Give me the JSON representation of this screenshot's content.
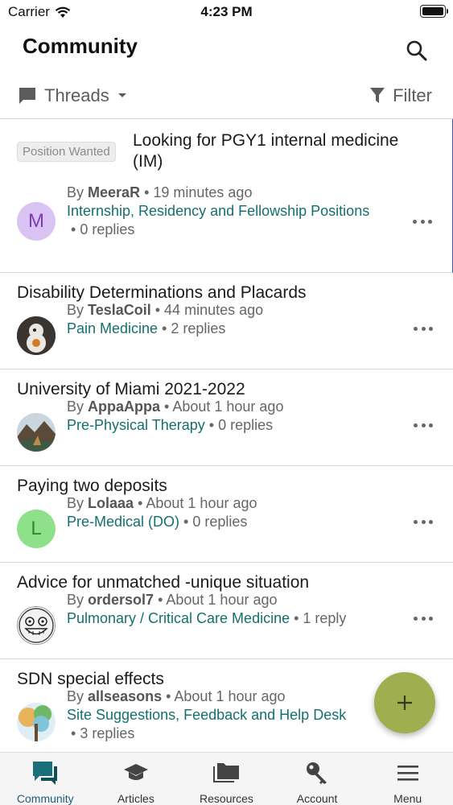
{
  "status_bar": {
    "carrier": "Carrier",
    "time": "4:23 PM"
  },
  "header": {
    "title": "Community"
  },
  "toolbar": {
    "threads_label": "Threads",
    "filter_label": "Filter"
  },
  "threads": [
    {
      "tag": "Position Wanted",
      "title": "Looking for PGY1 internal medicine (IM)",
      "by": "By",
      "author": "MeeraR",
      "time": "19 minutes ago",
      "category": "Internship, Residency and Fellowship Positions",
      "replies": "0 replies",
      "avatar_letter": "M"
    },
    {
      "title": "Disability Determinations and Placards",
      "by": "By",
      "author": "TeslaCoil",
      "time": "44 minutes ago",
      "category": "Pain Medicine",
      "replies": "2 replies"
    },
    {
      "title": "University of Miami 2021-2022",
      "by": "By",
      "author": "AppaAppa",
      "time": "About 1 hour ago",
      "category": "Pre-Physical Therapy",
      "replies": "0 replies"
    },
    {
      "title": "Paying two deposits",
      "by": "By",
      "author": "Lolaaa",
      "time": "About 1 hour ago",
      "category": "Pre-Medical (DO)",
      "replies": "0 replies",
      "avatar_letter": "L"
    },
    {
      "title": "Advice for unmatched -unique situation",
      "by": "By",
      "author": "ordersol7",
      "time": "About 1 hour ago",
      "category": "Pulmonary / Critical Care Medicine",
      "replies": "1 reply"
    },
    {
      "title": "SDN special effects",
      "by": "By",
      "author": "allseasons",
      "time": "About 1 hour ago",
      "category": "Site Suggestions, Feedback and Help Desk",
      "replies": "3 replies"
    }
  ],
  "tabs": [
    {
      "label": "Community",
      "icon": "chat-bubbles-icon"
    },
    {
      "label": "Articles",
      "icon": "graduation-cap-icon"
    },
    {
      "label": "Resources",
      "icon": "folders-icon"
    },
    {
      "label": "Account",
      "icon": "key-icon"
    },
    {
      "label": "Menu",
      "icon": "hamburger-icon"
    }
  ],
  "colors": {
    "accent": "#14706e",
    "fab": "#9fae4f",
    "active_tab": "#1e5d7a"
  }
}
